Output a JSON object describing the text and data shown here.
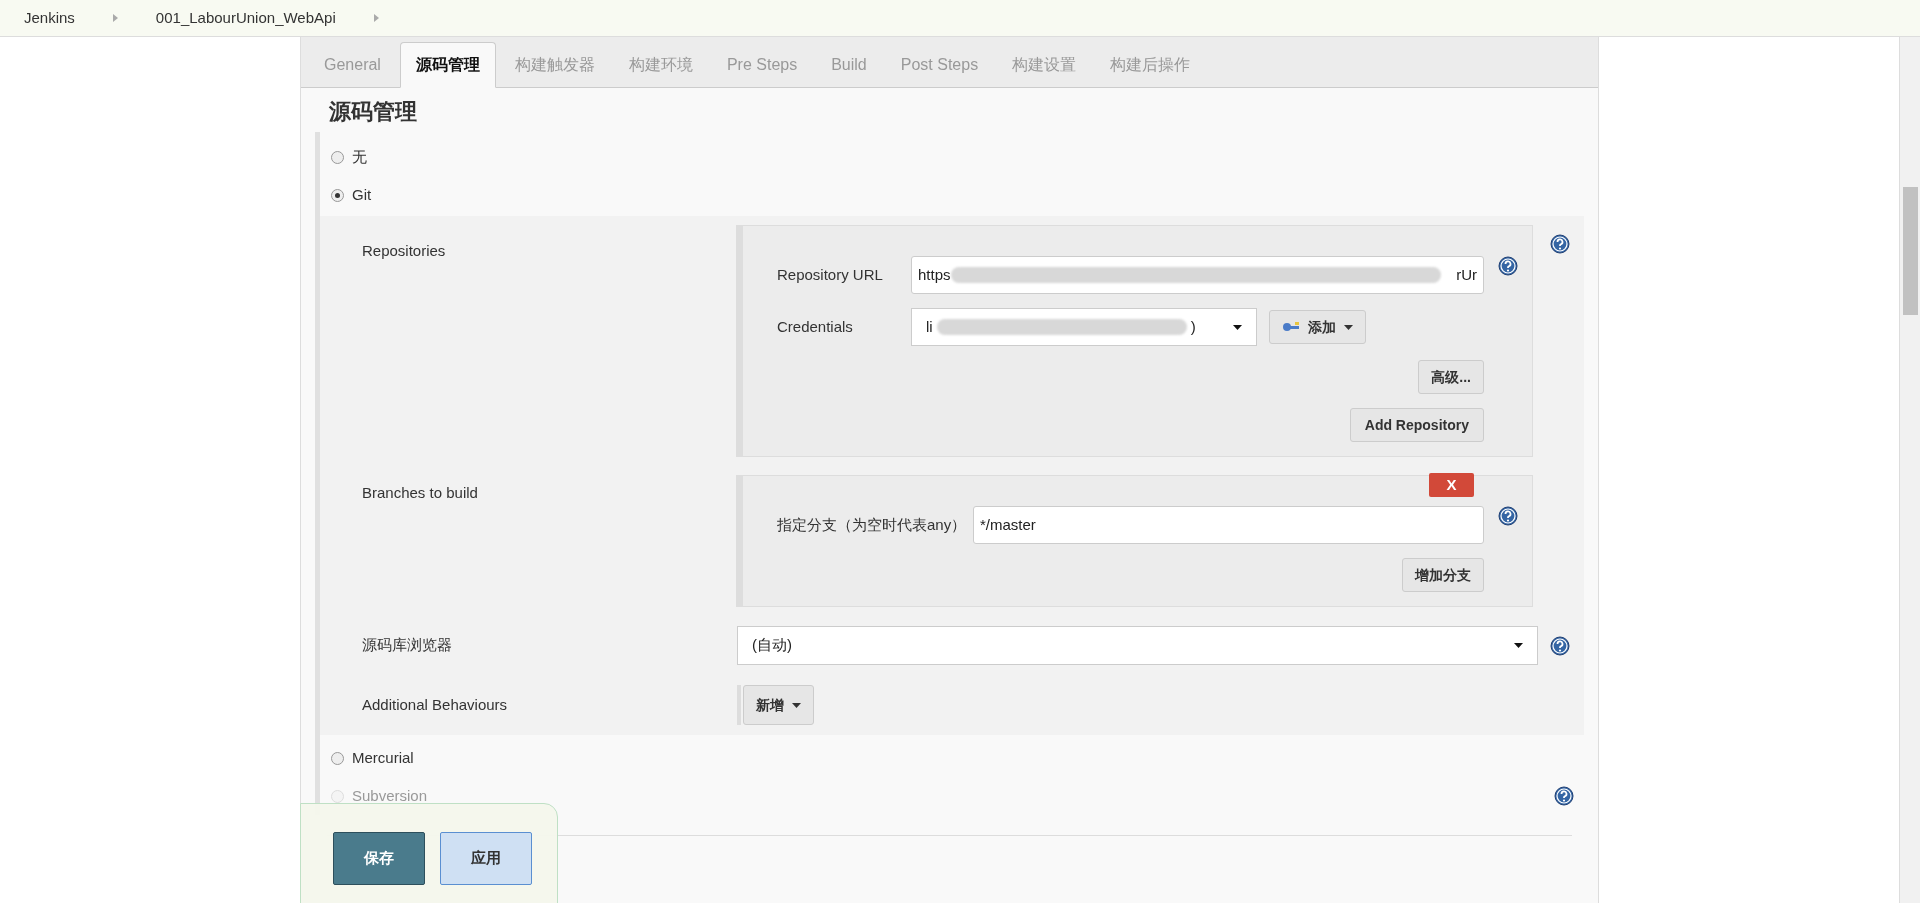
{
  "breadcrumbs": [
    {
      "label": "Jenkins"
    },
    {
      "label": "001_LabourUnion_WebApi"
    }
  ],
  "tabs": [
    {
      "label": "General",
      "selected": false
    },
    {
      "label": "源码管理",
      "selected": true
    },
    {
      "label": "构建触发器",
      "selected": false
    },
    {
      "label": "构建环境",
      "selected": false
    },
    {
      "label": "Pre Steps",
      "selected": false
    },
    {
      "label": "Build",
      "selected": false
    },
    {
      "label": "Post Steps",
      "selected": false
    },
    {
      "label": "构建设置",
      "selected": false
    },
    {
      "label": "构建后操作",
      "selected": false
    }
  ],
  "section_title": "源码管理",
  "scm_options": [
    {
      "label": "无",
      "selected": false,
      "disabled": false
    },
    {
      "label": "Git",
      "selected": true,
      "disabled": false
    }
  ],
  "git": {
    "repositories_label": "Repositories",
    "repository_url": {
      "label": "Repository URL",
      "value_start": "https",
      "value_end": "rUr"
    },
    "credentials": {
      "label": "Credentials",
      "value_start": "li",
      "value_end": ")",
      "add_button": "添加"
    },
    "advanced_button": "高级...",
    "add_repository_button": "Add Repository",
    "branches_label": "Branches to build",
    "branch": {
      "label": "指定分支（为空时代表any）",
      "value": "*/master",
      "delete_button": "X"
    },
    "add_branch_button": "增加分支",
    "browser_label": "源码库浏览器",
    "browser_value": "(自动)",
    "behaviours_label": "Additional Behaviours",
    "behaviours_button": "新增"
  },
  "more_options": [
    {
      "label": "Mercurial",
      "selected": false,
      "disabled": false
    },
    {
      "label": "Subversion",
      "selected": false,
      "disabled": true
    }
  ],
  "save_bar": {
    "save": "保存",
    "apply": "应用"
  }
}
